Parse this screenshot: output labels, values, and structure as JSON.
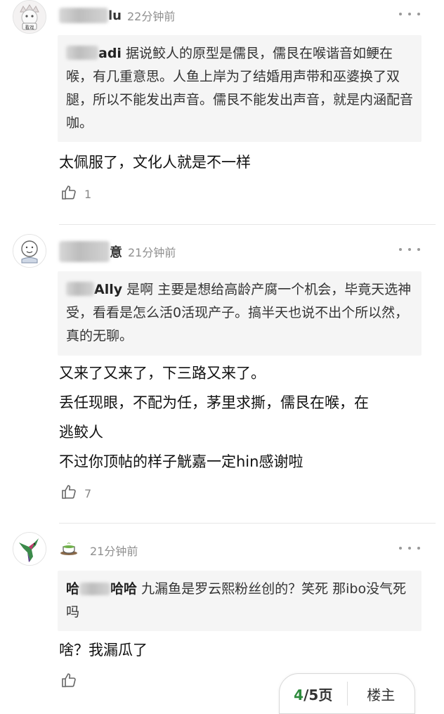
{
  "comments": [
    {
      "user": "lu",
      "time": "22分钟前",
      "quote_user": "adi",
      "quote_text": "据说鲛人的原型是儒艮，儒艮在喉谐音如鲠在喉，有几重意思。人鱼上岸为了结婚用声带和巫婆换了双腿，所以不能发出声音。儒艮不能发出声音，就是内涵配音咖。",
      "body": [
        "太佩服了，文化人就是不一样"
      ],
      "likes": "1",
      "avatar_text": "看戏"
    },
    {
      "user": "意",
      "time": "21分钟前",
      "quote_user": "Ally",
      "quote_text": "是啊 主要是想给高龄产腐一个机会，毕竟天选神受，看看是怎么活0活现产子。搞半天也说不出个所以然，真的无聊。",
      "body": [
        "又来了又来了，下三路又来了。",
        "丢任现眼，不配为任，茅里求撕，儒艮在喉，在",
        "逃鲛人",
        "不过你顶帖的样子觥嘉一定hin感谢啦"
      ],
      "likes": "7"
    },
    {
      "user": "",
      "time": "21分钟前",
      "quote_user": "哈",
      "quote_user_tail": "哈哈",
      "quote_text": "九漏鱼是罗云熙粉丝创的？笑死 那ibo没气死吗",
      "body": [
        "啥？我漏瓜了"
      ],
      "likes": ""
    }
  ],
  "pager": {
    "current": "4",
    "total": "/5页",
    "owner_label": "楼主"
  },
  "icons": [
    "more-icon",
    "thumbs-up-icon",
    "tea-cup-icon",
    "hummingbird-icon"
  ]
}
